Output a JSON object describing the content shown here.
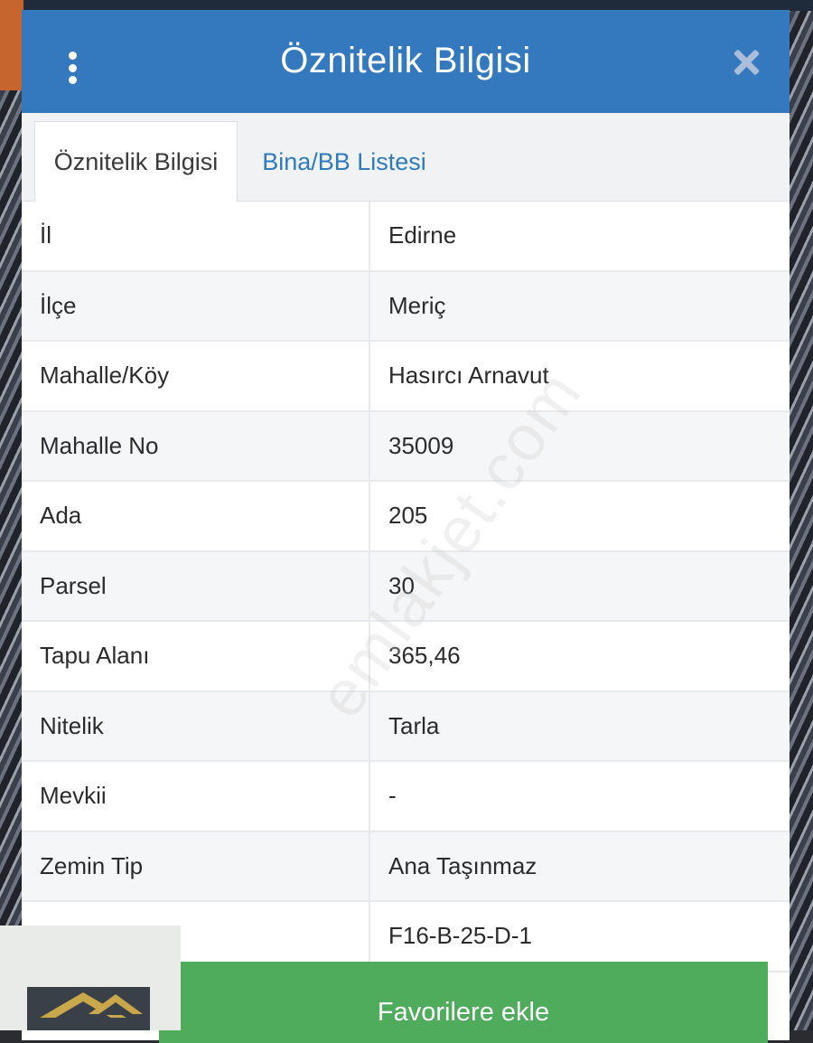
{
  "header": {
    "title": "Öznitelik Bilgisi",
    "menu_icon": "kebab-menu-icon",
    "close_icon": "close-icon",
    "color": "#3478be"
  },
  "tabs": [
    {
      "label": "Öznitelik Bilgisi",
      "active": true
    },
    {
      "label": "Bina/BB Listesi",
      "active": false
    }
  ],
  "attributes": [
    {
      "label": "İl",
      "value": "Edirne"
    },
    {
      "label": "İlçe",
      "value": "Meriç"
    },
    {
      "label": "Mahalle/Köy",
      "value": "Hasırcı Arnavut"
    },
    {
      "label": "Mahalle No",
      "value": "35009"
    },
    {
      "label": "Ada",
      "value": "205"
    },
    {
      "label": "Parsel",
      "value": "30"
    },
    {
      "label": "Tapu Alanı",
      "value": "365,46"
    },
    {
      "label": "Nitelik",
      "value": "Tarla"
    },
    {
      "label": "Mevkii",
      "value": "-"
    },
    {
      "label": "Zemin Tip",
      "value": "Ana Taşınmaz"
    },
    {
      "label": "",
      "value": "F16-B-25-D-1"
    }
  ],
  "actions": {
    "favorites_label": "Favorilere ekle",
    "favorites_color": "#4fac5c"
  },
  "watermark": "emlakjet.com"
}
